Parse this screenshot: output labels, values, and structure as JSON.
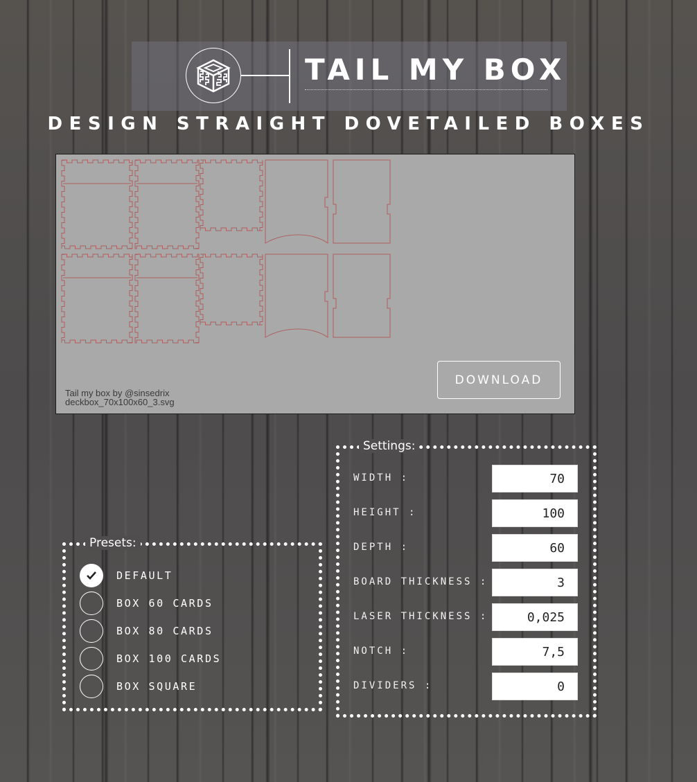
{
  "header": {
    "title": "TAIL MY BOX",
    "subtitle": "DESIGN STRAIGHT DOVETAILED BOXES",
    "logo_icon": "dovetail-box-icon"
  },
  "preview": {
    "credit_line1": "Tail my box by @sinsedrix",
    "credit_line2": "deckbox_70x100x60_3.svg",
    "download_label": "DOWNLOAD",
    "line_color": "#b06060",
    "background": "#a9a9a9"
  },
  "presets": {
    "legend": "Presets:",
    "items": [
      {
        "label": "DEFAULT",
        "checked": true
      },
      {
        "label": "BOX 60 CARDS",
        "checked": false
      },
      {
        "label": "BOX 80 CARDS",
        "checked": false
      },
      {
        "label": "BOX 100 CARDS",
        "checked": false
      },
      {
        "label": "BOX SQUARE",
        "checked": false
      }
    ]
  },
  "settings": {
    "legend": "Settings:",
    "fields": [
      {
        "label": "WIDTH :",
        "value": "70"
      },
      {
        "label": "HEIGHT :",
        "value": "100"
      },
      {
        "label": "DEPTH :",
        "value": "60"
      },
      {
        "label": "BOARD THICKNESS :",
        "value": "3"
      },
      {
        "label": "LASER THICKNESS :",
        "value": "0,025"
      },
      {
        "label": "NOTCH :",
        "value": "7,5"
      },
      {
        "label": "DIVIDERS :",
        "value": "0"
      }
    ]
  }
}
